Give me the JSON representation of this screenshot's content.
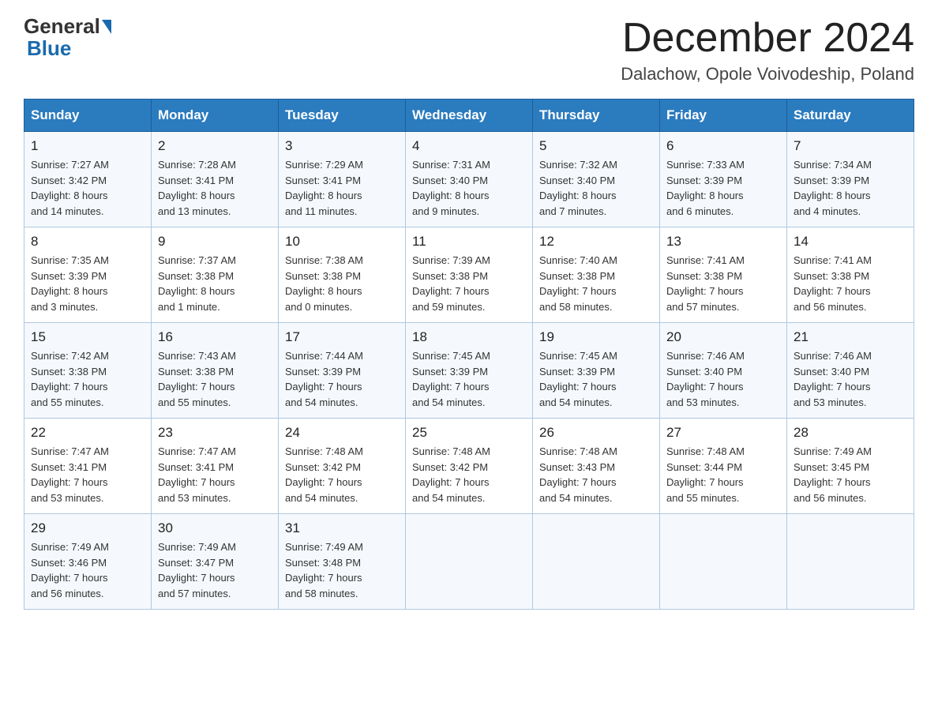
{
  "header": {
    "logo_general": "General",
    "logo_blue": "Blue",
    "month_year": "December 2024",
    "location": "Dalachow, Opole Voivodeship, Poland"
  },
  "days_of_week": [
    "Sunday",
    "Monday",
    "Tuesday",
    "Wednesday",
    "Thursday",
    "Friday",
    "Saturday"
  ],
  "weeks": [
    [
      {
        "day": "1",
        "sunrise": "7:27 AM",
        "sunset": "3:42 PM",
        "daylight": "8 hours and 14 minutes."
      },
      {
        "day": "2",
        "sunrise": "7:28 AM",
        "sunset": "3:41 PM",
        "daylight": "8 hours and 13 minutes."
      },
      {
        "day": "3",
        "sunrise": "7:29 AM",
        "sunset": "3:41 PM",
        "daylight": "8 hours and 11 minutes."
      },
      {
        "day": "4",
        "sunrise": "7:31 AM",
        "sunset": "3:40 PM",
        "daylight": "8 hours and 9 minutes."
      },
      {
        "day": "5",
        "sunrise": "7:32 AM",
        "sunset": "3:40 PM",
        "daylight": "8 hours and 7 minutes."
      },
      {
        "day": "6",
        "sunrise": "7:33 AM",
        "sunset": "3:39 PM",
        "daylight": "8 hours and 6 minutes."
      },
      {
        "day": "7",
        "sunrise": "7:34 AM",
        "sunset": "3:39 PM",
        "daylight": "8 hours and 4 minutes."
      }
    ],
    [
      {
        "day": "8",
        "sunrise": "7:35 AM",
        "sunset": "3:39 PM",
        "daylight": "8 hours and 3 minutes."
      },
      {
        "day": "9",
        "sunrise": "7:37 AM",
        "sunset": "3:38 PM",
        "daylight": "8 hours and 1 minute."
      },
      {
        "day": "10",
        "sunrise": "7:38 AM",
        "sunset": "3:38 PM",
        "daylight": "8 hours and 0 minutes."
      },
      {
        "day": "11",
        "sunrise": "7:39 AM",
        "sunset": "3:38 PM",
        "daylight": "7 hours and 59 minutes."
      },
      {
        "day": "12",
        "sunrise": "7:40 AM",
        "sunset": "3:38 PM",
        "daylight": "7 hours and 58 minutes."
      },
      {
        "day": "13",
        "sunrise": "7:41 AM",
        "sunset": "3:38 PM",
        "daylight": "7 hours and 57 minutes."
      },
      {
        "day": "14",
        "sunrise": "7:41 AM",
        "sunset": "3:38 PM",
        "daylight": "7 hours and 56 minutes."
      }
    ],
    [
      {
        "day": "15",
        "sunrise": "7:42 AM",
        "sunset": "3:38 PM",
        "daylight": "7 hours and 55 minutes."
      },
      {
        "day": "16",
        "sunrise": "7:43 AM",
        "sunset": "3:38 PM",
        "daylight": "7 hours and 55 minutes."
      },
      {
        "day": "17",
        "sunrise": "7:44 AM",
        "sunset": "3:39 PM",
        "daylight": "7 hours and 54 minutes."
      },
      {
        "day": "18",
        "sunrise": "7:45 AM",
        "sunset": "3:39 PM",
        "daylight": "7 hours and 54 minutes."
      },
      {
        "day": "19",
        "sunrise": "7:45 AM",
        "sunset": "3:39 PM",
        "daylight": "7 hours and 54 minutes."
      },
      {
        "day": "20",
        "sunrise": "7:46 AM",
        "sunset": "3:40 PM",
        "daylight": "7 hours and 53 minutes."
      },
      {
        "day": "21",
        "sunrise": "7:46 AM",
        "sunset": "3:40 PM",
        "daylight": "7 hours and 53 minutes."
      }
    ],
    [
      {
        "day": "22",
        "sunrise": "7:47 AM",
        "sunset": "3:41 PM",
        "daylight": "7 hours and 53 minutes."
      },
      {
        "day": "23",
        "sunrise": "7:47 AM",
        "sunset": "3:41 PM",
        "daylight": "7 hours and 53 minutes."
      },
      {
        "day": "24",
        "sunrise": "7:48 AM",
        "sunset": "3:42 PM",
        "daylight": "7 hours and 54 minutes."
      },
      {
        "day": "25",
        "sunrise": "7:48 AM",
        "sunset": "3:42 PM",
        "daylight": "7 hours and 54 minutes."
      },
      {
        "day": "26",
        "sunrise": "7:48 AM",
        "sunset": "3:43 PM",
        "daylight": "7 hours and 54 minutes."
      },
      {
        "day": "27",
        "sunrise": "7:48 AM",
        "sunset": "3:44 PM",
        "daylight": "7 hours and 55 minutes."
      },
      {
        "day": "28",
        "sunrise": "7:49 AM",
        "sunset": "3:45 PM",
        "daylight": "7 hours and 56 minutes."
      }
    ],
    [
      {
        "day": "29",
        "sunrise": "7:49 AM",
        "sunset": "3:46 PM",
        "daylight": "7 hours and 56 minutes."
      },
      {
        "day": "30",
        "sunrise": "7:49 AM",
        "sunset": "3:47 PM",
        "daylight": "7 hours and 57 minutes."
      },
      {
        "day": "31",
        "sunrise": "7:49 AM",
        "sunset": "3:48 PM",
        "daylight": "7 hours and 58 minutes."
      },
      null,
      null,
      null,
      null
    ]
  ],
  "labels": {
    "sunrise": "Sunrise:",
    "sunset": "Sunset:",
    "daylight": "Daylight:"
  }
}
